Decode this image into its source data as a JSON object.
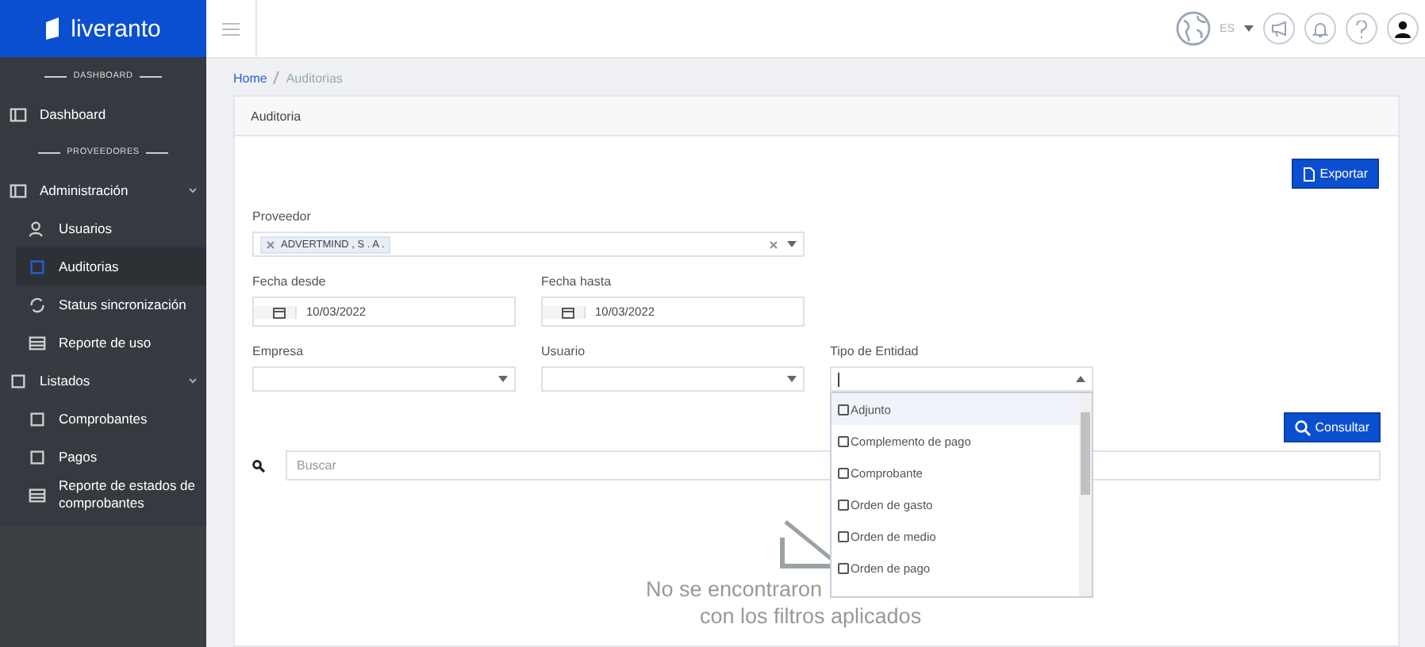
{
  "brand": {
    "name": "liveranto"
  },
  "topbar": {
    "language": "ES"
  },
  "sidebar": {
    "items": [
      {
        "kind": "header",
        "label": "DASHBOARD"
      },
      {
        "kind": "link",
        "label": "Dashboard",
        "selected": false
      },
      {
        "kind": "header",
        "label": "PROVEEDORES"
      },
      {
        "kind": "group",
        "label": "Administración",
        "expanded": true,
        "children": [
          {
            "label": "Usuarios",
            "selected": false
          },
          {
            "label": "Auditorias",
            "selected": true
          },
          {
            "label": "Status sincronización",
            "selected": false
          },
          {
            "label": "Reporte de uso",
            "selected": false
          }
        ]
      },
      {
        "kind": "group",
        "label": "Listados",
        "expanded": true,
        "children": [
          {
            "label": "Comprobantes",
            "selected": false
          },
          {
            "label": "Pagos",
            "selected": false
          },
          {
            "label": "Reporte de estados de comprobantes",
            "selected": false
          }
        ]
      }
    ]
  },
  "breadcrumb": [
    "Home",
    "Auditorias"
  ],
  "card": {
    "title": "Auditoria",
    "export_button": "Exportar",
    "proveedor": {
      "label": "Proveedor",
      "tags": [
        "ADVERTMIND , S . A ."
      ]
    },
    "fecha_desde": {
      "label": "Fecha desde",
      "value": "10/03/2022"
    },
    "fecha_hasta": {
      "label": "Fecha hasta",
      "value": "10/03/2022"
    },
    "empresa": {
      "label": "Empresa"
    },
    "usuario": {
      "label": "Usuario"
    },
    "tipo_entidad": {
      "label": "Tipo de Entidad",
      "expanded": true,
      "options": [
        {
          "label": "Adjunto",
          "checked": false,
          "selected": true
        },
        {
          "label": "Complemento de pago",
          "checked": false,
          "selected": false
        },
        {
          "label": "Comprobante",
          "checked": false,
          "selected": false
        },
        {
          "label": "Orden de gasto",
          "checked": false,
          "selected": false
        },
        {
          "label": "Orden de medio",
          "checked": false,
          "selected": false
        },
        {
          "label": "Orden de pago",
          "checked": false,
          "selected": false
        }
      ]
    },
    "consult_button": "Consultar",
    "search": {
      "placeholder": "Buscar"
    },
    "empty": [
      "No se encontraron",
      "con los filtros aplicados"
    ]
  }
}
